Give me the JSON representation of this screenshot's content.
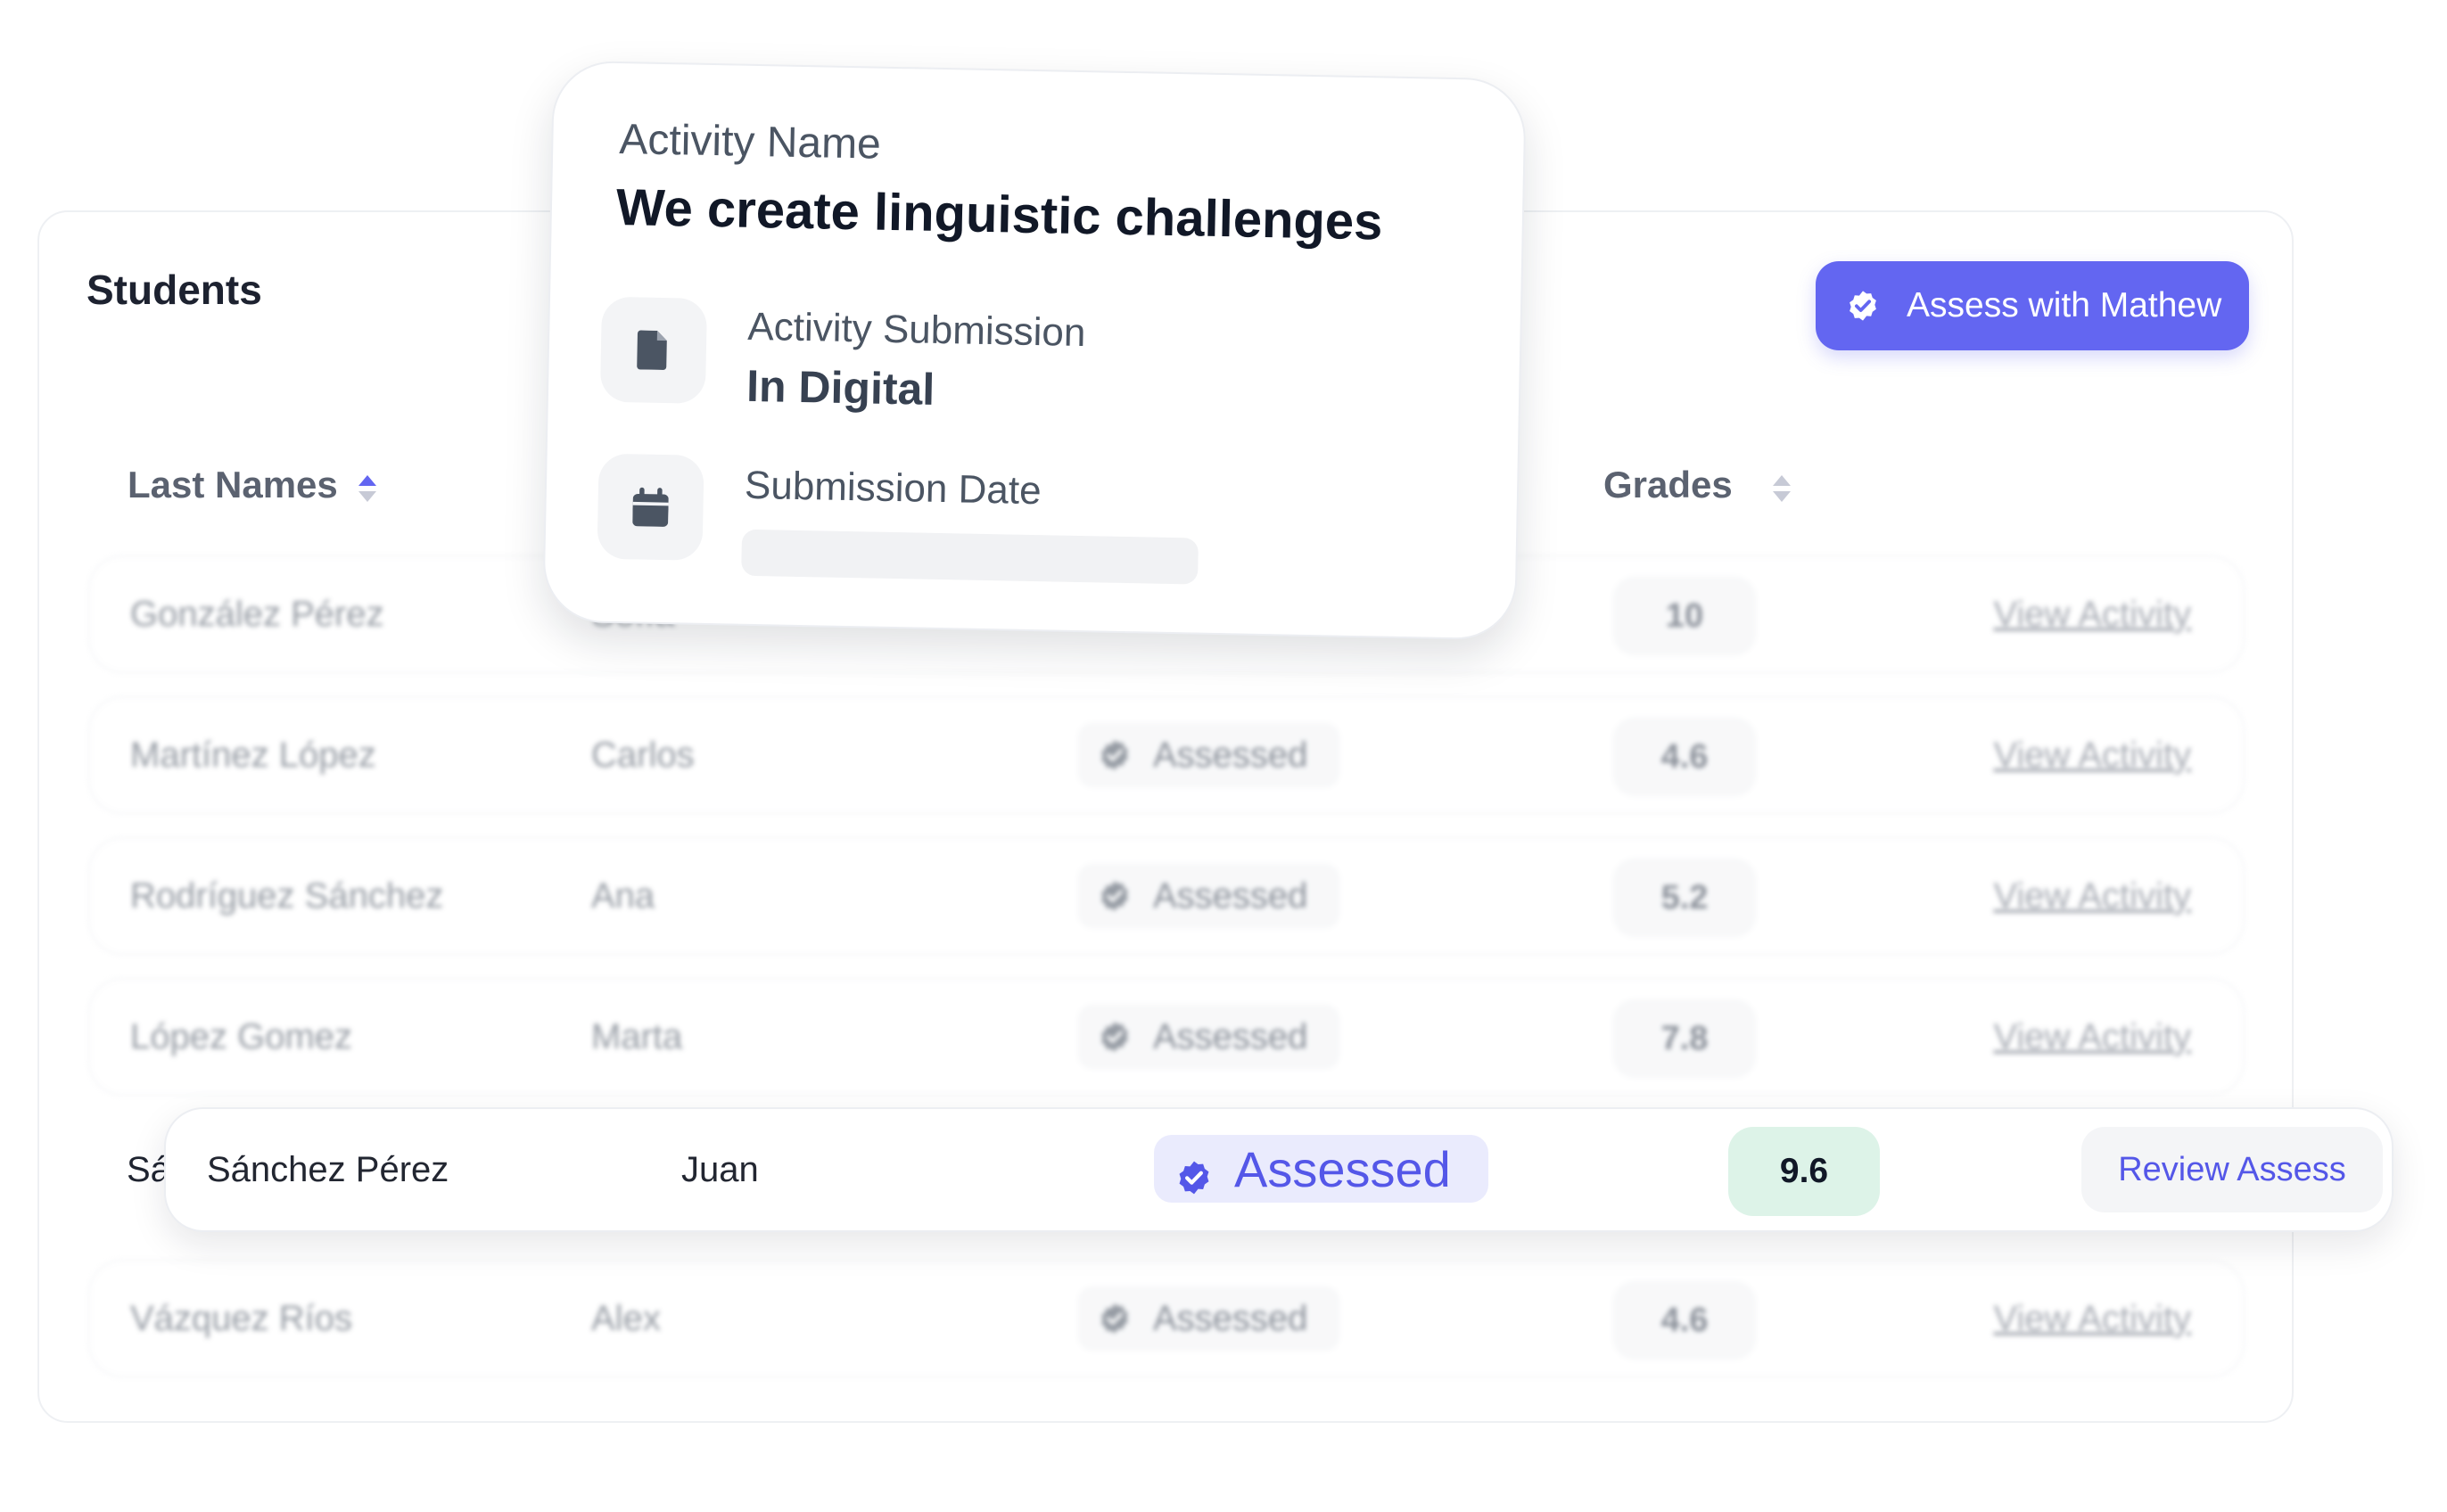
{
  "panel": {
    "title": "Students",
    "assess_button_label": "Assess with Mathew"
  },
  "columns": {
    "last_names": "Last Names",
    "grades": "Grades"
  },
  "rows": [
    {
      "last": "González Pérez",
      "first": "Sofía",
      "status": "",
      "grade": "10",
      "action": "View Activity"
    },
    {
      "last": "Martínez López",
      "first": "Carlos",
      "status": "Assessed",
      "grade": "4.6",
      "action": "View Activity"
    },
    {
      "last": "Rodríguez Sánchez",
      "first": "Ana",
      "status": "Assessed",
      "grade": "5.2",
      "action": "View Activity"
    },
    {
      "last": "López Gomez",
      "first": "Marta",
      "status": "Assessed",
      "grade": "7.8",
      "action": "View Activity"
    },
    {
      "last": "Vázquez Ríos",
      "first": "Alex",
      "status": "Assessed",
      "grade": "4.6",
      "action": "View Activity"
    }
  ],
  "highlighted": {
    "peek": "Sá",
    "last": "Sánchez Pérez",
    "first": "Juan",
    "status": "Assessed",
    "grade": "9.6",
    "action": "Review Assess"
  },
  "card": {
    "activity_label": "Activity Name",
    "activity_name": "We create linguistic challenges",
    "submission_label": "Activity Submission",
    "submission_value": "In Digital",
    "date_label": "Submission Date",
    "date_value": ""
  },
  "colors": {
    "accent": "#6366f1",
    "grade_highlight_bg": "#ddf3e8",
    "assessed_bg": "#eaebfd"
  },
  "icons": {
    "assess_button": "check-badge-icon",
    "submission": "document-icon",
    "date": "calendar-icon",
    "sort": "sort-icon",
    "status": "check-badge-icon"
  }
}
